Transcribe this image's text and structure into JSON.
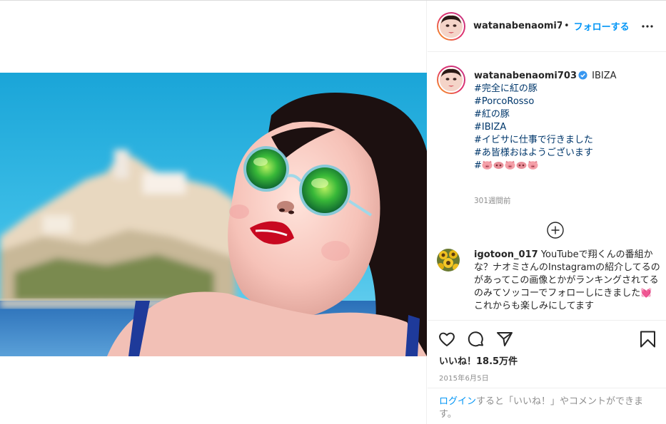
{
  "header": {
    "username": "watanabenaomi703",
    "separator": "•",
    "follow_label": "フォローする",
    "more_icon": "more-horizontal-icon"
  },
  "caption": {
    "username": "watanabenaomi703",
    "location": "IBIZA",
    "lines": [
      "#完全に紅の豚",
      "#PorcoRosso",
      "#紅の豚",
      "#IBIZA",
      "#イビサに仕事で行きました",
      "#あ皆様おはようございます"
    ],
    "last_line_prefix": "#",
    "emoji": [
      "pig-face",
      "pig-nose",
      "pig-face",
      "pig-nose",
      "pig-face"
    ],
    "time_ago": "301週間前"
  },
  "comment": {
    "username": "igotoon_017",
    "text": "YouTubeで翔くんの番組かな？ナオミさんのInstagramの紹介してるのがあってこの画像とかがランキングされてるのみてソッコーでフォローしにきました💓これからも楽しみにしてます"
  },
  "actions": {
    "likes_label": "いいね！18.5万件",
    "date": "2015年6月5日"
  },
  "login_bar": {
    "link": "ログイン",
    "text": "すると「いいね！」やコメントができます。"
  },
  "colors": {
    "accent": "#0095f6",
    "hashtag": "#00376b",
    "muted": "#8e8e8e",
    "text": "#262626"
  }
}
